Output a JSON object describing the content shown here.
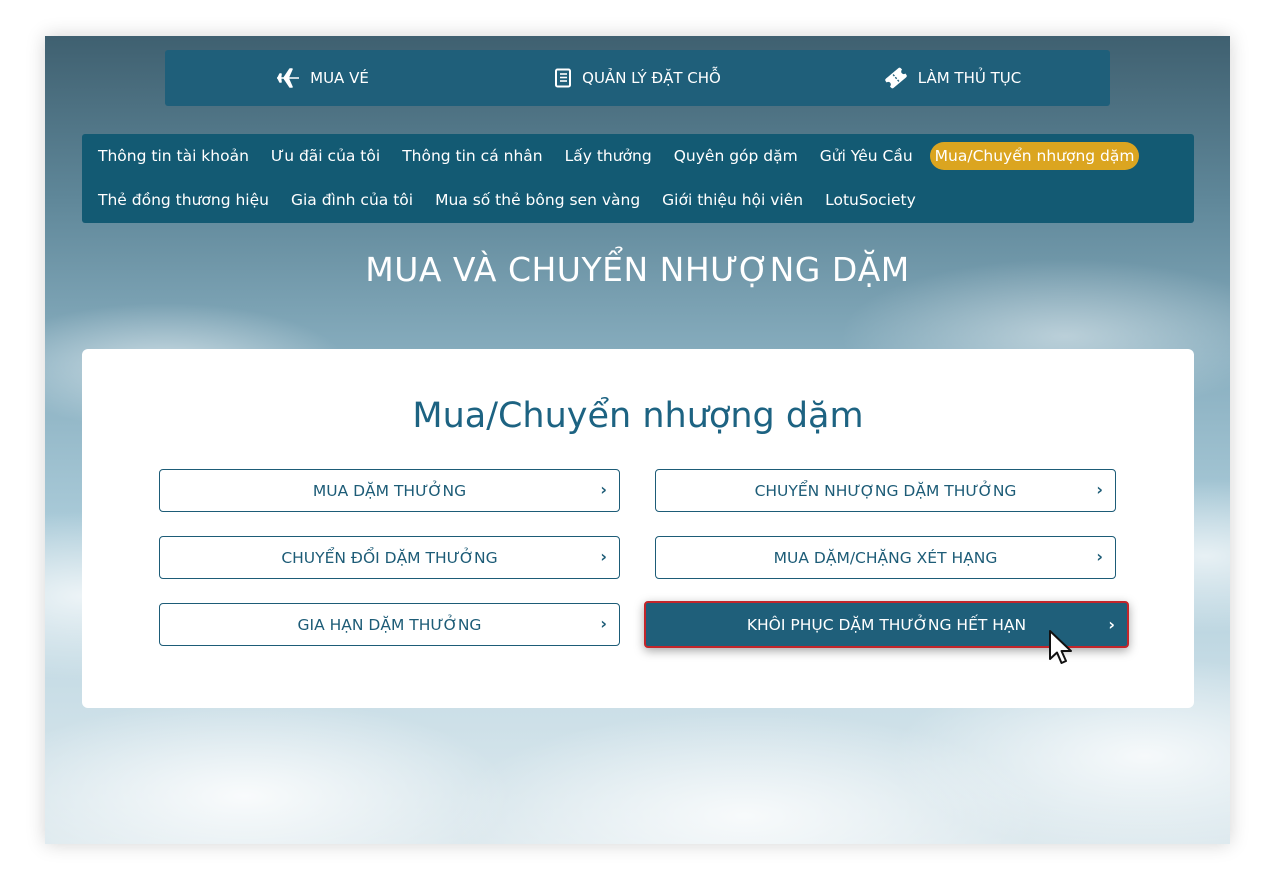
{
  "top_nav": {
    "items": [
      {
        "label": "MUA VÉ",
        "icon": "plane-icon"
      },
      {
        "label": "QUẢN LÝ ĐẶT CHỖ",
        "icon": "booking-book-icon"
      },
      {
        "label": "LÀM THỦ TỤC",
        "icon": "ticket-icon"
      }
    ]
  },
  "sub_nav": {
    "row1": [
      "Thông tin tài khoản",
      "Ưu đãi của tôi",
      "Thông tin cá nhân",
      "Lấy thưởng",
      "Quyên góp dặm",
      "Gửi Yêu Cầu",
      "Mua/Chuyển nhượng dặm"
    ],
    "row2": [
      "Thẻ đồng thương hiệu",
      "Gia đình của tôi",
      "Mua số thẻ bông sen vàng",
      "Giới thiệu hội viên",
      "LotuSociety"
    ],
    "active": "Mua/Chuyển nhượng dặm",
    "active_color": "#dba520"
  },
  "page_heading": "MUA VÀ CHUYỂN NHƯỢNG DẶM",
  "card": {
    "title": "Mua/Chuyển nhượng dặm",
    "options": [
      {
        "label": "MUA DẶM THƯỞNG",
        "chevron": "›"
      },
      {
        "label": "CHUYỂN NHƯỢNG DẶM THƯỞNG",
        "chevron": "›"
      },
      {
        "label": "CHUYỂN ĐỔI DẶM THƯỞNG",
        "chevron": "›"
      },
      {
        "label": "MUA DẶM/CHẶNG XÉT HẠNG",
        "chevron": "›"
      },
      {
        "label": "GIA HẠN DẶM THƯỞNG",
        "chevron": "›"
      },
      {
        "label": "KHÔI PHỤC DẶM THƯỞNG HẾT HẠN",
        "chevron": "›"
      }
    ],
    "selected": "KHÔI PHỤC DẶM THƯỞNG HẾT HẠN"
  },
  "colors": {
    "primary": "#1f5f7a",
    "subnav_bg": "#135a73",
    "selected_border": "#c3262b",
    "title_text": "#1d6382"
  }
}
